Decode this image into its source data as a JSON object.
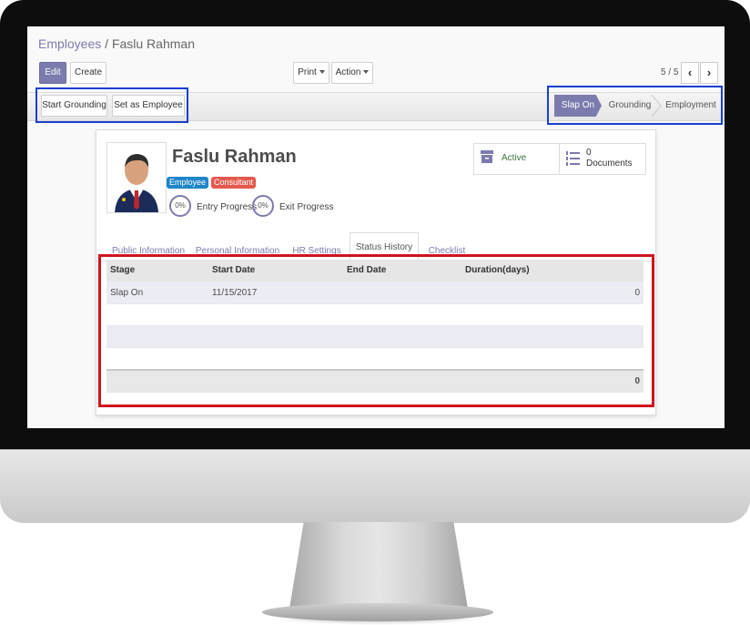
{
  "breadcrumb": {
    "parent": "Employees",
    "separator": "/",
    "current": "Faslu Rahman"
  },
  "toolbar": {
    "edit_label": "Edit",
    "create_label": "Create",
    "print_label": "Print",
    "action_label": "Action"
  },
  "pager": {
    "value": "5 / 5",
    "prev": "‹",
    "next": "›"
  },
  "header_buttons": {
    "start_grounding": "Start Grounding",
    "set_as_employee": "Set as Employee"
  },
  "stages": [
    "Slap On",
    "Grounding",
    "Employment"
  ],
  "active_stage": "Slap On",
  "employee": {
    "name": "Faslu Rahman",
    "tags": [
      {
        "label": "Employee",
        "color": "#1f86c9"
      },
      {
        "label": "Consultant",
        "color": "#e55a4e"
      }
    ],
    "entry_progress": {
      "value": "0%",
      "label": "Entry Progress"
    },
    "exit_progress": {
      "value": "0%",
      "label": "Exit Progress"
    }
  },
  "smart_buttons": {
    "active_label": "Active",
    "documents_count": "0",
    "documents_label": "Documents"
  },
  "tabs": [
    "Public Information",
    "Personal Information",
    "HR Settings",
    "Status History",
    "Checklist"
  ],
  "active_tab": "Status History",
  "status_history": {
    "columns": [
      "Stage",
      "Start Date",
      "End Date",
      "Duration(days)"
    ],
    "rows": [
      {
        "stage": "Slap On",
        "start_date": "11/15/2017",
        "end_date": "",
        "duration": "0"
      }
    ],
    "total": "0"
  },
  "colors": {
    "accent": "#7c7bad",
    "highlight_blue": "#1a3fd1",
    "highlight_red": "#d0141f",
    "active_green": "#3c763d"
  }
}
